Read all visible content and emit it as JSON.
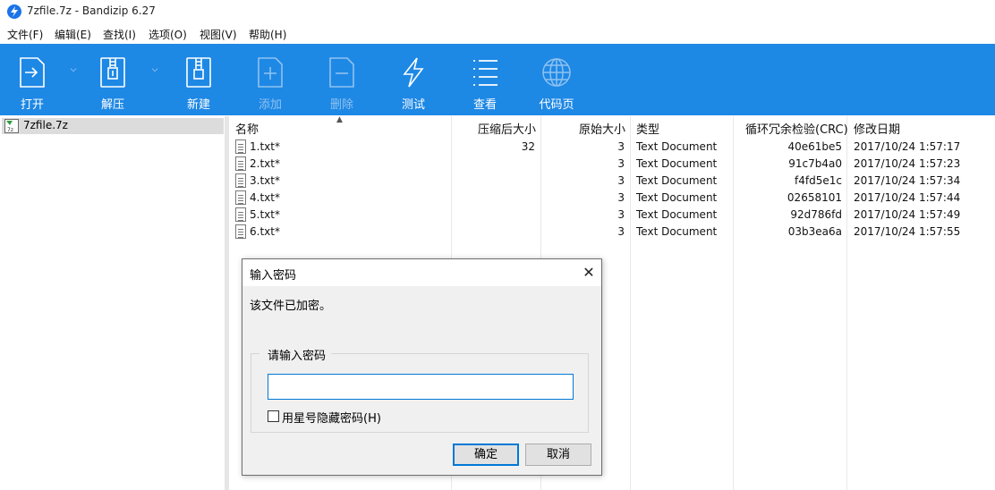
{
  "window": {
    "title": "7zfile.7z - Bandizip 6.27"
  },
  "menu": [
    "文件(F)",
    "编辑(E)",
    "查找(I)",
    "选项(O)",
    "视图(V)",
    "帮助(H)"
  ],
  "toolbar": {
    "open": "打开",
    "extract": "解压",
    "new": "新建",
    "add": "添加",
    "delete": "删除",
    "test": "测试",
    "view": "查看",
    "codepage": "代码页"
  },
  "sidebar": {
    "archive": "7zfile.7z"
  },
  "columns": {
    "name": "名称",
    "compressed": "压缩后大小",
    "original": "原始大小",
    "type": "类型",
    "crc": "循环冗余检验(CRC)",
    "modified": "修改日期"
  },
  "files": [
    {
      "name": "1.txt*",
      "compressed": "32",
      "original": "3",
      "type": "Text Document",
      "crc": "40e61be5",
      "modified": "2017/10/24 1:57:17"
    },
    {
      "name": "2.txt*",
      "compressed": "",
      "original": "3",
      "type": "Text Document",
      "crc": "91c7b4a0",
      "modified": "2017/10/24 1:57:23"
    },
    {
      "name": "3.txt*",
      "compressed": "",
      "original": "3",
      "type": "Text Document",
      "crc": "f4fd5e1c",
      "modified": "2017/10/24 1:57:34"
    },
    {
      "name": "4.txt*",
      "compressed": "",
      "original": "3",
      "type": "Text Document",
      "crc": "02658101",
      "modified": "2017/10/24 1:57:44"
    },
    {
      "name": "5.txt*",
      "compressed": "",
      "original": "3",
      "type": "Text Document",
      "crc": "92d786fd",
      "modified": "2017/10/24 1:57:49"
    },
    {
      "name": "6.txt*",
      "compressed": "",
      "original": "3",
      "type": "Text Document",
      "crc": "03b3ea6a",
      "modified": "2017/10/24 1:57:55"
    }
  ],
  "dialog": {
    "title": "输入密码",
    "message": "该文件已加密。",
    "group_label": "请输入密码",
    "password_value": "",
    "mask_label": "用星号隐藏密码(H)",
    "mask_checked": false,
    "ok": "确定",
    "cancel": "取消"
  },
  "colors": {
    "toolbar_bg": "#1e88e5",
    "selection_bg": "#dcdcdc",
    "focus_border": "#0078d7"
  }
}
